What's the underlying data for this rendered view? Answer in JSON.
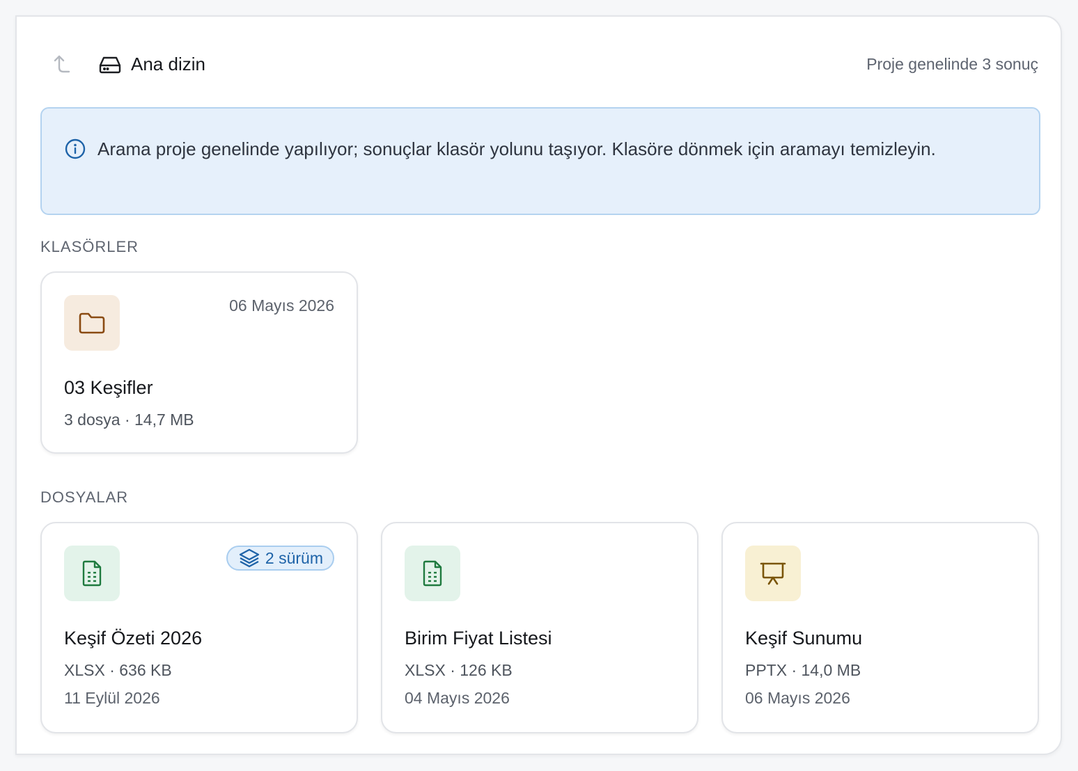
{
  "toolbar": {
    "up_icon": "arrow-up-left-icon",
    "directory_icon": "hard-drive-icon",
    "directory_label": "Ana dizin",
    "result_count": "Proje genelinde 3 sonuç"
  },
  "notice": {
    "icon": "info-icon",
    "text": "Arama proje genelinde yapılıyor; sonuçlar klasör yolunu taşıyor. Klasöre dönmek için aramayı temizleyin."
  },
  "folders_section": {
    "title": "KLASÖRLER",
    "items": [
      {
        "icon": "folder-icon",
        "date": "06 Mayıs 2026",
        "name": "03 Keşifler",
        "meta": "3 dosya · 14,7 MB"
      }
    ]
  },
  "files_section": {
    "title": "DOSYALAR",
    "items": [
      {
        "icon": "spreadsheet-icon",
        "badge": "2 sürüm",
        "badge_icon": "layers-icon",
        "name": "Keşif Özeti 2026",
        "meta": "XLSX · 636 KB",
        "date": "11 Eylül 2026"
      },
      {
        "icon": "spreadsheet-icon",
        "name": "Birim Fiyat Listesi",
        "meta": "XLSX · 126 KB",
        "date": "04 Mayıs 2026"
      },
      {
        "icon": "presentation-icon",
        "name": "Keşif Sunumu",
        "meta": "PPTX · 14,0 MB",
        "date": "06 Mayıs 2026"
      }
    ]
  },
  "colors": {
    "folder_bg": "#f6ebdf",
    "folder_fg": "#8a4b12",
    "sheet_bg": "#e3f3ea",
    "sheet_fg": "#1f7a3f",
    "slides_bg": "#f8f0d3",
    "slides_fg": "#7a5508",
    "info_bg": "#e6f0fb",
    "accent": "#1e63a8"
  }
}
